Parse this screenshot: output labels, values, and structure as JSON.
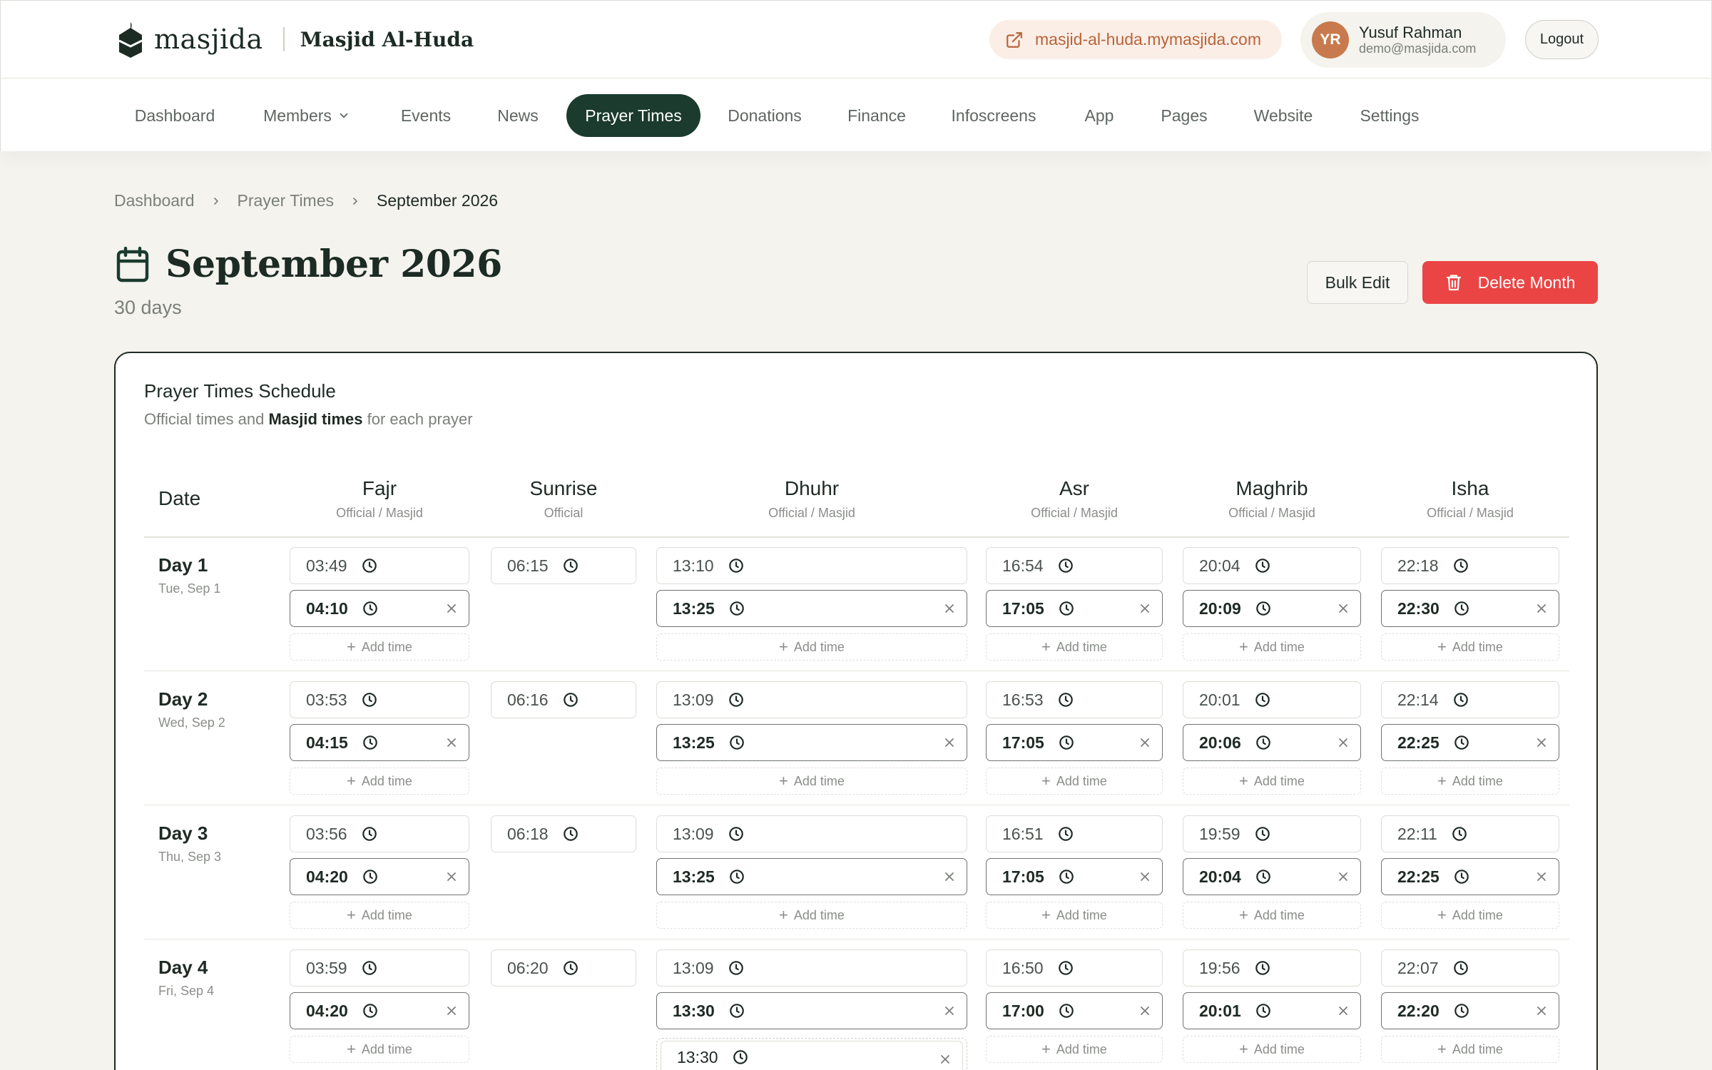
{
  "brand": {
    "logo_text": "masjida",
    "org_name": "Masjid Al-Huda"
  },
  "header": {
    "site_link": "masjid-al-huda.mymasjida.com",
    "user_initials": "YR",
    "user_name": "Yusuf Rahman",
    "user_email": "demo@masjida.com",
    "logout_label": "Logout"
  },
  "nav": {
    "items": [
      "Dashboard",
      "Members",
      "Events",
      "News",
      "Prayer Times",
      "Donations",
      "Finance",
      "Infoscreens",
      "App",
      "Pages",
      "Website",
      "Settings"
    ],
    "active": "Prayer Times"
  },
  "breadcrumb": [
    "Dashboard",
    "Prayer Times",
    "September 2026"
  ],
  "page": {
    "title": "September 2026",
    "subtitle": "30 days",
    "bulk_edit_label": "Bulk Edit",
    "delete_label": "Delete Month"
  },
  "card": {
    "title": "Prayer Times Schedule",
    "desc_pre": "Official times and ",
    "desc_bold": "Masjid times",
    "desc_post": " for each prayer"
  },
  "table": {
    "date_header": "Date",
    "add_time_label": "Add time",
    "columns": [
      {
        "name": "Fajr",
        "sub": "Official / Masjid"
      },
      {
        "name": "Sunrise",
        "sub": "Official"
      },
      {
        "name": "Dhuhr",
        "sub": "Official / Masjid"
      },
      {
        "name": "Asr",
        "sub": "Official / Masjid"
      },
      {
        "name": "Maghrib",
        "sub": "Official / Masjid"
      },
      {
        "name": "Isha",
        "sub": "Official / Masjid"
      }
    ],
    "rows": [
      {
        "day": "Day 1",
        "date": "Tue, Sep 1",
        "fajr": [
          "03:49",
          "04:10"
        ],
        "sunrise": [
          "06:15"
        ],
        "dhuhr": [
          "13:10",
          "13:25"
        ],
        "asr": [
          "16:54",
          "17:05"
        ],
        "maghrib": [
          "20:04",
          "20:09"
        ],
        "isha": [
          "22:18",
          "22:30"
        ]
      },
      {
        "day": "Day 2",
        "date": "Wed, Sep 2",
        "fajr": [
          "03:53",
          "04:15"
        ],
        "sunrise": [
          "06:16"
        ],
        "dhuhr": [
          "13:09",
          "13:25"
        ],
        "asr": [
          "16:53",
          "17:05"
        ],
        "maghrib": [
          "20:01",
          "20:06"
        ],
        "isha": [
          "22:14",
          "22:25"
        ]
      },
      {
        "day": "Day 3",
        "date": "Thu, Sep 3",
        "fajr": [
          "03:56",
          "04:20"
        ],
        "sunrise": [
          "06:18"
        ],
        "dhuhr": [
          "13:09",
          "13:25"
        ],
        "asr": [
          "16:51",
          "17:05"
        ],
        "maghrib": [
          "19:59",
          "20:04"
        ],
        "isha": [
          "22:11",
          "22:25"
        ]
      },
      {
        "day": "Day 4",
        "date": "Fri, Sep 4",
        "fajr": [
          "03:59",
          "04:20"
        ],
        "sunrise": [
          "06:20"
        ],
        "dhuhr": [
          "13:09",
          "13:30",
          "13:30"
        ],
        "asr": [
          "16:50",
          "17:00"
        ],
        "maghrib": [
          "19:56",
          "20:01"
        ],
        "isha": [
          "22:07",
          "22:20"
        ]
      }
    ]
  },
  "colors": {
    "brand_dark": "#1a3b2e",
    "danger": "#ea4444",
    "link_accent": "#b8643a",
    "page_bg": "#f4f3ee"
  },
  "icons": [
    "masjida-logo-icon",
    "external-link-icon",
    "chevron-down-icon",
    "chevron-right-icon",
    "calendar-icon",
    "trash-icon",
    "clock-icon",
    "close-icon",
    "plus-icon"
  ]
}
